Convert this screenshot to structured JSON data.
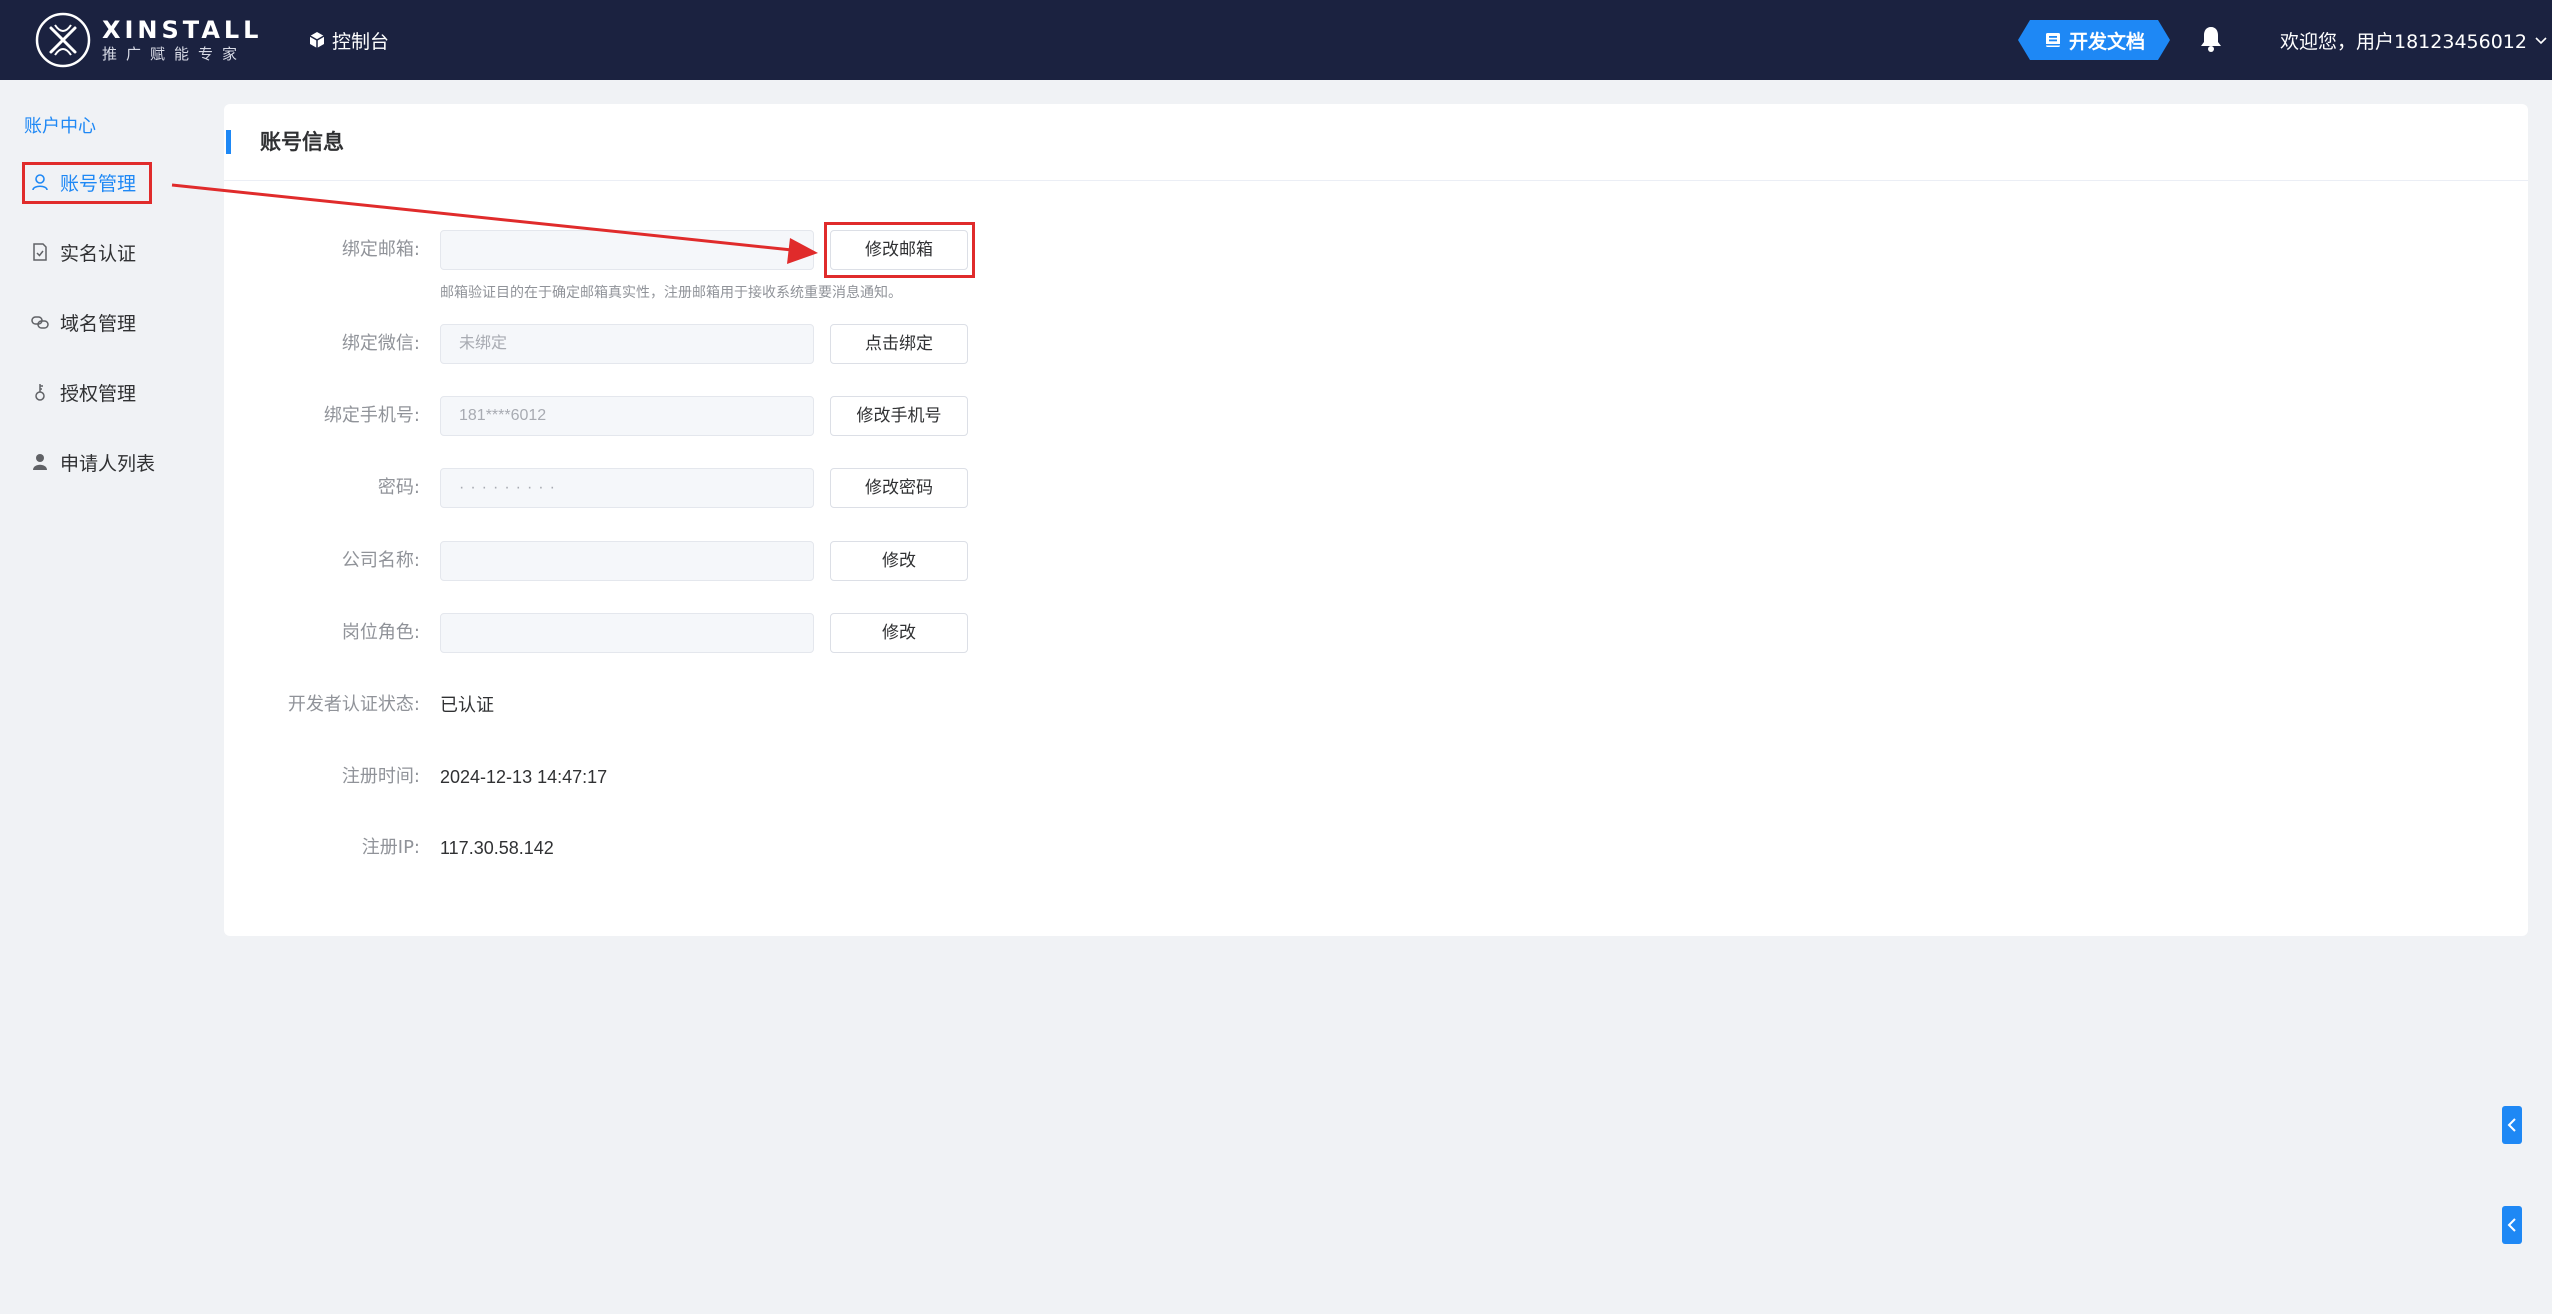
{
  "header": {
    "logo_title": "XINSTALL",
    "logo_subtitle": "推广赋能专家",
    "console_label": "控制台",
    "docs_label": "开发文档",
    "welcome_text": "欢迎您，用户18123456012"
  },
  "sidebar": {
    "section_title": "账户中心",
    "items": [
      {
        "label": "账号管理",
        "icon": "user-icon",
        "active": true
      },
      {
        "label": "实名认证",
        "icon": "document-check-icon"
      },
      {
        "label": "域名管理",
        "icon": "link-icon"
      },
      {
        "label": "授权管理",
        "icon": "key-icon"
      },
      {
        "label": "申请人列表",
        "icon": "person-icon"
      }
    ]
  },
  "main": {
    "title": "账号信息",
    "email": {
      "label": "绑定邮箱:",
      "value": "",
      "button": "修改邮箱",
      "hint": "邮箱验证目的在于确定邮箱真实性，注册邮箱用于接收系统重要消息通知。"
    },
    "wechat": {
      "label": "绑定微信:",
      "value": "未绑定",
      "button": "点击绑定"
    },
    "phone": {
      "label": "绑定手机号:",
      "value": "181****6012",
      "button": "修改手机号"
    },
    "password": {
      "label": "密码:",
      "value": "·········",
      "button": "修改密码"
    },
    "company": {
      "label": "公司名称:",
      "value": "",
      "button": "修改"
    },
    "position": {
      "label": "岗位角色:",
      "value": "",
      "button": "修改"
    },
    "dev_status": {
      "label": "开发者认证状态:",
      "value": "已认证"
    },
    "reg_time": {
      "label": "注册时间:",
      "value": "2024-12-13 14:47:17"
    },
    "reg_ip": {
      "label": "注册IP:",
      "value": "117.30.58.142"
    }
  },
  "colors": {
    "header_bg": "#1b2240",
    "accent": "#1e88f5",
    "annotation_red": "#e02b2b",
    "page_bg": "#f0f2f5"
  }
}
